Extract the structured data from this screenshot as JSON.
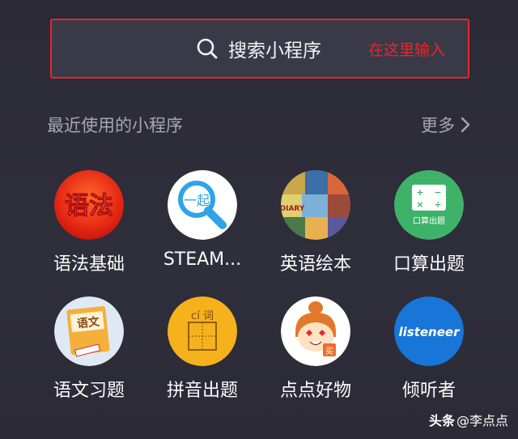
{
  "search": {
    "icon": "search-icon",
    "label": "搜索小程序",
    "hint": "在这里输入",
    "hint_color": "#e8262a",
    "border_color": "#e4282b"
  },
  "recent": {
    "title": "最近使用的小程序",
    "more_label": "更多",
    "more_icon": "chevron-right-icon"
  },
  "apps": [
    {
      "name": "语法基础",
      "icon": "grammar-basics-icon",
      "icon_text": "语法"
    },
    {
      "name": "STEAM...",
      "icon": "steam-magnifier-icon",
      "icon_text": "一起"
    },
    {
      "name": "英语绘本",
      "icon": "english-picture-books-icon",
      "icon_text": "DIARY"
    },
    {
      "name": "口算出题",
      "icon": "mental-math-icon",
      "icon_text": "口算出题"
    },
    {
      "name": "语文习题",
      "icon": "chinese-exercise-book-icon",
      "icon_text": "语文"
    },
    {
      "name": "拼音出题",
      "icon": "pinyin-ci-icon",
      "icon_text": "cí 词"
    },
    {
      "name": "点点好物",
      "icon": "diandian-cartoon-girl-icon",
      "icon_text": "买"
    },
    {
      "name": "倾听者",
      "icon": "listeneer-icon",
      "icon_text": "listeneer"
    }
  ],
  "watermark": {
    "prefix": "头条",
    "handle": "@李点点"
  }
}
